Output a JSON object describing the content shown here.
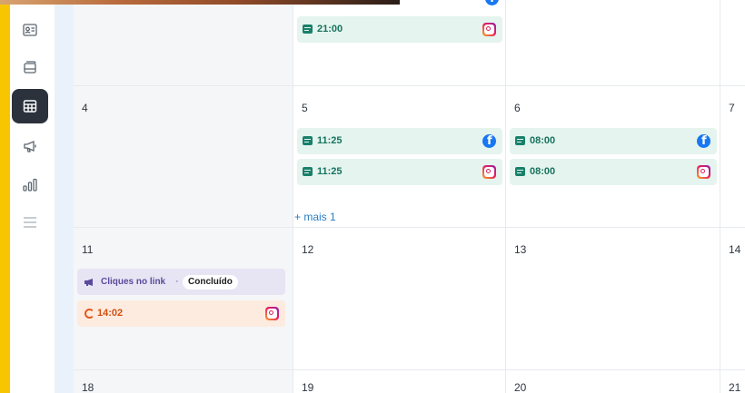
{
  "sidebar": {
    "accent_color": "#f7c600",
    "items": [
      {
        "name": "contact-card-icon",
        "active": false
      },
      {
        "name": "layers-icon",
        "active": false
      },
      {
        "name": "calendar-icon",
        "active": true
      },
      {
        "name": "megaphone-icon",
        "active": false
      },
      {
        "name": "bar-chart-icon",
        "active": false
      },
      {
        "name": "menu-icon",
        "active": false
      }
    ]
  },
  "calendar": {
    "week0": {
      "col1_events": [
        {
          "time": "21:00",
          "network": "instagram"
        }
      ]
    },
    "week1": {
      "days": [
        "4",
        "5",
        "6",
        "7"
      ],
      "day5_events": [
        {
          "time": "11:25",
          "network": "facebook"
        },
        {
          "time": "11:25",
          "network": "instagram"
        }
      ],
      "day6_events": [
        {
          "time": "08:00",
          "network": "facebook"
        },
        {
          "time": "08:00",
          "network": "instagram"
        }
      ],
      "more_label": "+ mais 1"
    },
    "week2": {
      "days": [
        "11",
        "12",
        "13",
        "14"
      ],
      "ad_event": {
        "label": "Cliques no link",
        "separator": "·",
        "status": "Concluído"
      },
      "pending_event": {
        "time": "14:02",
        "network": "instagram"
      }
    },
    "week3": {
      "days": [
        "18",
        "19",
        "20",
        "21"
      ]
    }
  }
}
